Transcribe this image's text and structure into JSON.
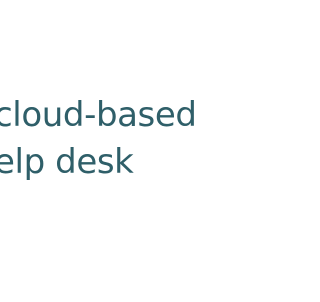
{
  "headline": {
    "line1": "cloud-based",
    "line2": "elp desk"
  },
  "colors": {
    "background": "#ffffff",
    "text": "#2f5f69"
  }
}
